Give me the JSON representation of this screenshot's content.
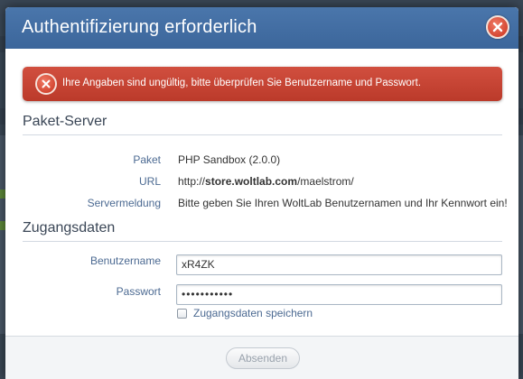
{
  "dialog": {
    "title": "Authentifizierung erforderlich"
  },
  "error": {
    "message": "Ihre Angaben sind ungültig, bitte überprüfen Sie Benutzername und Passwort."
  },
  "package_server": {
    "heading": "Paket-Server",
    "rows": [
      {
        "label": "Paket",
        "value": "PHP Sandbox (2.0.0)"
      },
      {
        "label": "URL",
        "value_prefix": "http://",
        "value_bold": "store.woltlab.com",
        "value_suffix": "/maelstrom/"
      },
      {
        "label": "Servermeldung",
        "value": "Bitte geben Sie Ihren WoltLab Benutzernamen und Ihr Kennwort ein!"
      }
    ]
  },
  "credentials": {
    "heading": "Zugangsdaten",
    "username_label": "Benutzername",
    "username_value": "xR4ZK",
    "password_label": "Passwort",
    "password_mask": "•••••••••••",
    "save_label": "Zugangsdaten speichern",
    "save_checked": false
  },
  "footer": {
    "submit_label": "Absenden"
  },
  "colors": {
    "titlebar": "#4470a5",
    "error_bg": "#c8412f",
    "label_blue": "#4c6a92"
  }
}
